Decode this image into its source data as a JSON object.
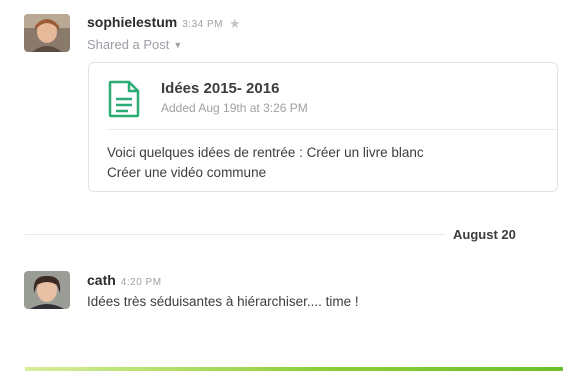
{
  "messages": [
    {
      "username": "sophielestum",
      "time": "3:34 PM",
      "subline": "Shared a Post",
      "post": {
        "title": "Idées 2015- 2016",
        "added": "Added Aug 19th at 3:26 PM",
        "preview_line1": "Voici quelques idées de rentrée : Créer un livre blanc",
        "preview_line2": "Créer une vidéo commune"
      }
    },
    {
      "username": "cath",
      "time": "4:20 PM",
      "text": "Idées très séduisantes à hiérarchiser.... time !"
    }
  ],
  "day_divider": {
    "label": "August 20"
  },
  "icons": {
    "star": "star-icon",
    "caret": "caret-down-icon",
    "post": "document-icon"
  },
  "colors": {
    "post_icon": "#2bac76",
    "progress": "#7cc83a"
  }
}
